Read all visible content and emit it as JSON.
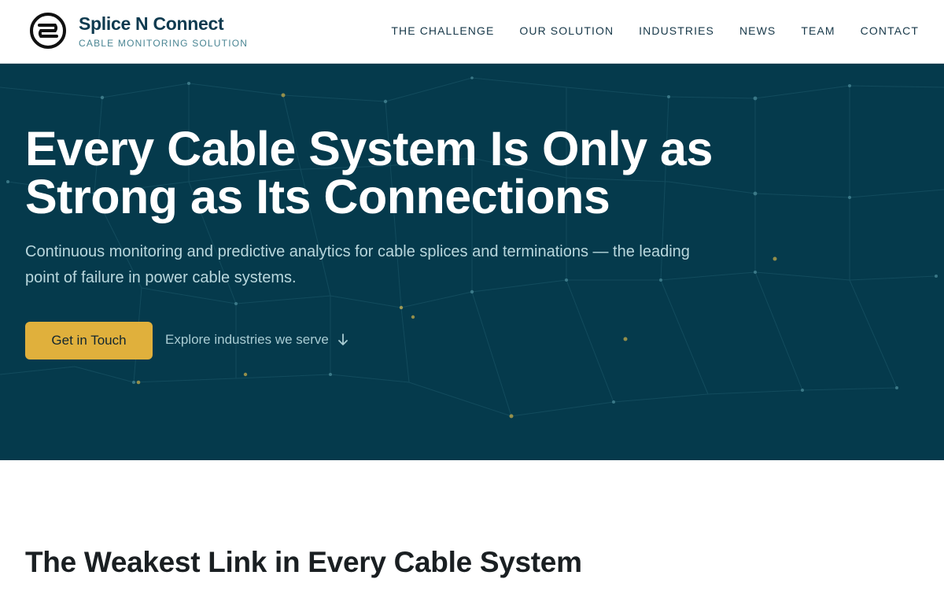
{
  "header": {
    "brand_name": "Splice N Connect",
    "brand_tagline": "CABLE MONITORING SOLUTION",
    "logo_icon": "splice-logo-icon",
    "nav": [
      {
        "label": "THE CHALLENGE"
      },
      {
        "label": "OUR SOLUTION"
      },
      {
        "label": "INDUSTRIES"
      },
      {
        "label": "NEWS"
      },
      {
        "label": "TEAM"
      },
      {
        "label": "CONTACT"
      }
    ]
  },
  "hero": {
    "title": "Every Cable System Is Only as Strong as Its Connections",
    "subtitle": "Continuous monitoring and predictive analytics for cable splices and terminations — the leading point of failure in power cable systems.",
    "primary_button": "Get in Touch",
    "secondary_link": "Explore industries we serve",
    "secondary_icon": "arrow-down-icon"
  },
  "challenge": {
    "title": "The Weakest Link in Every Cable System"
  },
  "colors": {
    "brand": "#0e3a4f",
    "hero_bg": "#053a4c",
    "accent": "#e0b03c",
    "tagline": "#4a8593"
  }
}
